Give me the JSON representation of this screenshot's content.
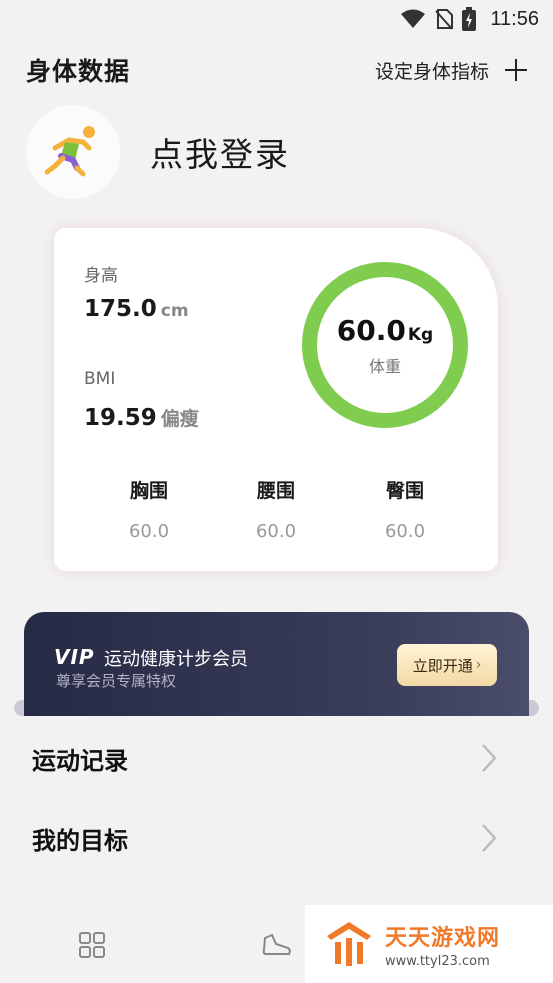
{
  "status_bar": {
    "time": "11:56"
  },
  "header": {
    "title": "身体数据",
    "set_target_label": "设定身体指标"
  },
  "profile": {
    "login_prompt": "点我登录"
  },
  "body_card": {
    "height_label": "身高",
    "height_value": "175.0",
    "height_unit": "cm",
    "bmi_label": "BMI",
    "bmi_value": "19.59",
    "bmi_status": "偏瘦",
    "weight_value": "60.0",
    "weight_unit": "Kg",
    "weight_label": "体重",
    "measurements": [
      {
        "label": "胸围",
        "value": "60.0"
      },
      {
        "label": "腰围",
        "value": "60.0"
      },
      {
        "label": "臀围",
        "value": "60.0"
      }
    ]
  },
  "vip": {
    "logo": "VIP",
    "title": "运动健康计步会员",
    "subtitle": "尊享会员专属特权",
    "button_label": "立即开通"
  },
  "list": [
    {
      "label": "运动记录"
    },
    {
      "label": "我的目标"
    }
  ],
  "watermark": {
    "name": "天天游戏网",
    "url": "www.ttyl23.com"
  },
  "colors": {
    "ring": "#7fcc4f",
    "vip_bg": "#2e3150",
    "background": "#f2f2f2"
  }
}
